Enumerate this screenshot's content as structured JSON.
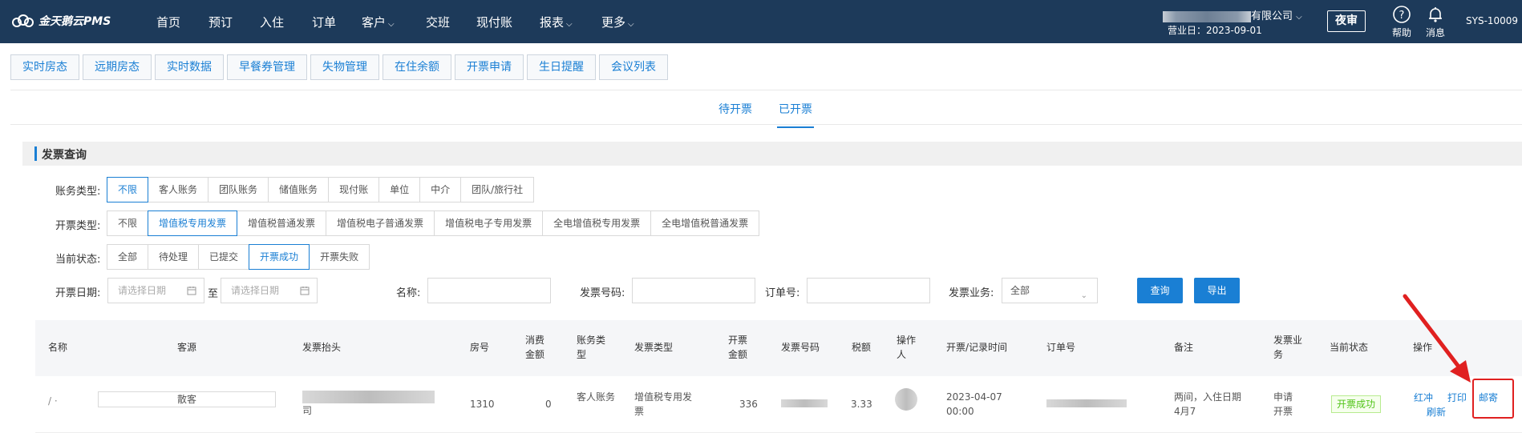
{
  "nav": {
    "brand": "金天鹅云PMS",
    "items": [
      {
        "label": "首页",
        "caret": false
      },
      {
        "label": "预订",
        "caret": false
      },
      {
        "label": "入住",
        "caret": false
      },
      {
        "label": "订单",
        "caret": false
      },
      {
        "label": "客户",
        "caret": true
      },
      {
        "label": "交班",
        "caret": false
      },
      {
        "label": "现付账",
        "caret": false
      },
      {
        "label": "报表",
        "caret": true
      },
      {
        "label": "更多",
        "caret": true
      }
    ],
    "company_suffix": "有限公司",
    "business_date": "营业日：2023-09-01",
    "night_audit": "夜审",
    "help": "帮助",
    "messages": "消息",
    "sys_id": "SYS-10009"
  },
  "tabs": [
    "实时房态",
    "远期房态",
    "实时数据",
    "早餐券管理",
    "失物管理",
    "在住余额",
    "开票申请",
    "生日提醒",
    "会议列表"
  ],
  "status_tabs": {
    "pending": "待开票",
    "done": "已开票",
    "active": "done"
  },
  "query": {
    "title": "发票查询",
    "account_type": {
      "label": "账务类型:",
      "options": [
        "不限",
        "客人账务",
        "团队账务",
        "储值账务",
        "现付账",
        "单位",
        "中介",
        "团队/旅行社"
      ],
      "selected": 0
    },
    "invoice_type": {
      "label": "开票类型:",
      "options": [
        "不限",
        "增值税专用发票",
        "增值税普通发票",
        "增值税电子普通发票",
        "增值税电子专用发票",
        "全电增值税专用发票",
        "全电增值税普通发票"
      ],
      "selected": 1
    },
    "current_status": {
      "label": "当前状态:",
      "options": [
        "全部",
        "待处理",
        "已提交",
        "开票成功",
        "开票失败"
      ],
      "selected": 3
    },
    "date_label": "开票日期:",
    "date_start_placeholder": "请选择日期",
    "date_to": "至",
    "date_end_placeholder": "请选择日期",
    "name_label": "名称:",
    "invoice_no_label": "发票号码:",
    "order_no_label": "订单号:",
    "business_label": "发票业务:",
    "business_value": "全部",
    "search_button": "查询",
    "export_button": "导出"
  },
  "table": {
    "headers": {
      "name": "名称",
      "source": "客源",
      "title": "发票抬头",
      "room": "房号",
      "consume": "消费金额",
      "account_type": "账务类型",
      "invoice_type": "发票类型",
      "amount": "开票金额",
      "invoice_no": "发票号码",
      "tax": "税额",
      "operator": "操作人",
      "time": "开票/记录时间",
      "order_no": "订单号",
      "remark": "备注",
      "business": "发票业务",
      "status": "当前状态",
      "ops": "操作"
    },
    "row": {
      "source": "散客",
      "title_suffix": "司",
      "room": "1310",
      "consume": "0",
      "account_type": "客人账务",
      "invoice_type": "增值税专用发票",
      "amount": "336",
      "tax": "3.33",
      "time": "2023-04-07 00:00",
      "remark": "两间，入住日期4月7",
      "business": "申请开票",
      "status": "开票成功",
      "op_red": "红冲",
      "op_print": "打印",
      "op_refresh": "刷新",
      "op_mail": "邮寄"
    }
  },
  "colors": {
    "nav_bg": "#1d3a5a",
    "accent": "#1a7fd4",
    "success": "#52c41a",
    "highlight": "#e02020"
  }
}
